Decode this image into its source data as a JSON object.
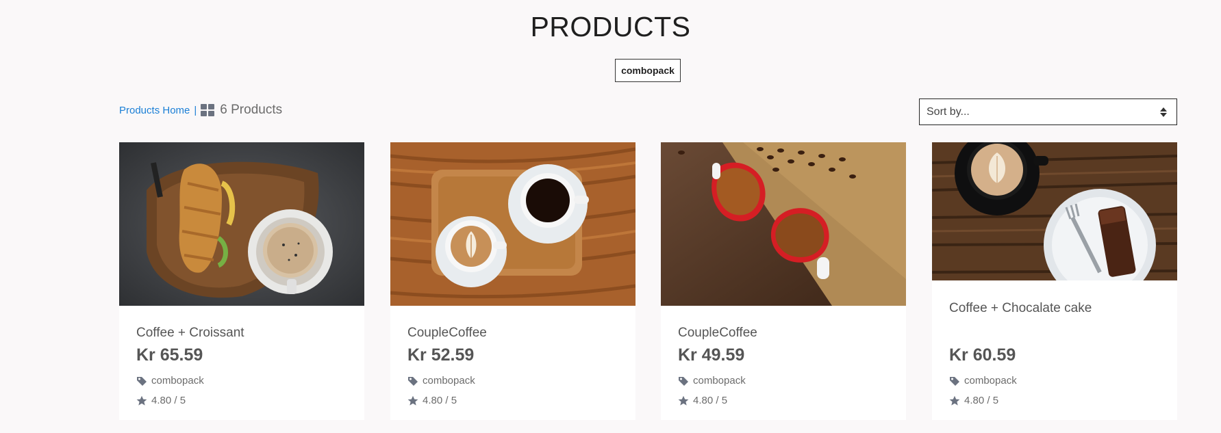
{
  "page": {
    "title": "PRODUCTS",
    "active_tag": "combopack"
  },
  "toolbar": {
    "home_link": "Products Home",
    "separator": "|",
    "count_label": "6 Products",
    "sort_placeholder": "Sort by..."
  },
  "products": [
    {
      "name": "Coffee + Croissant",
      "price": "Kr 65.59",
      "tag": "combopack",
      "rating": "4.80 / 5",
      "image": "croissant-and-coffee-photo"
    },
    {
      "name": "CoupleCoffee",
      "price": "Kr 52.59",
      "tag": "combopack",
      "rating": "4.80 / 5",
      "image": "latte-and-black-coffee-photo"
    },
    {
      "name": "CoupleCoffee",
      "price": "Kr 49.59",
      "tag": "combopack",
      "rating": "4.80 / 5",
      "image": "heart-cups-coffee-photo"
    },
    {
      "name": "Coffee + Chocalate cake",
      "price": "Kr 60.59",
      "tag": "combopack",
      "rating": "4.80 / 5",
      "image": "coffee-and-cake-photo"
    }
  ],
  "icons": {
    "grid": "grid-icon",
    "tag": "tag-icon",
    "star": "star-icon",
    "sort": "sort-arrows-icon"
  },
  "colors": {
    "link": "#1a7fd6",
    "background": "#faf8f9",
    "card": "#ffffff"
  }
}
